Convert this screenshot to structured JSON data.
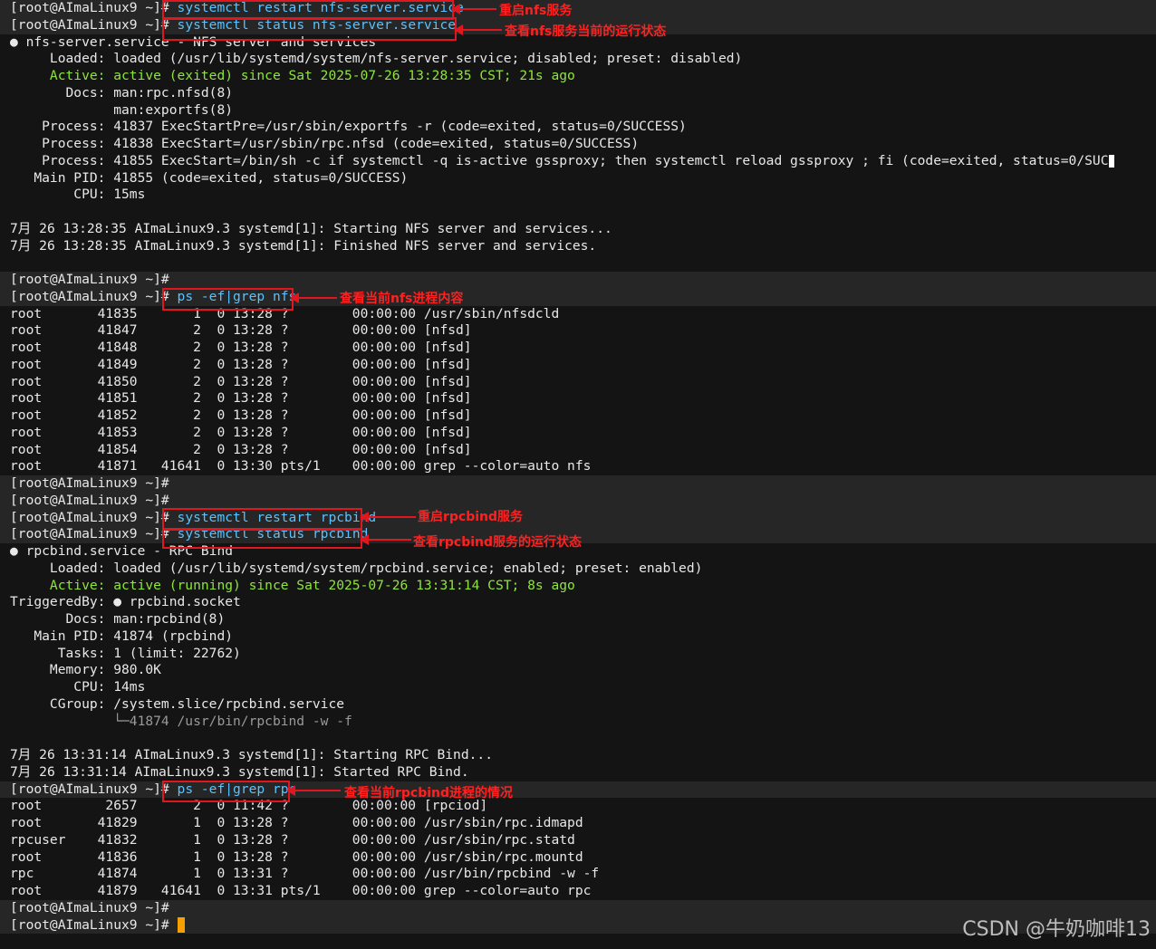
{
  "prompt": "[root@AImaLinux9 ~]#",
  "cmds": {
    "c1": "systemctl restart nfs-server.service",
    "c2": "systemctl status nfs-server.service",
    "c3": "ps -ef|grep nfs",
    "c4": "systemctl restart rpcbind",
    "c5": "systemctl status rpcbind",
    "c6": "ps -ef|grep rpc"
  },
  "annotations": {
    "a1": "重启nfs服务",
    "a2": "查看nfs服务当前的运行状态",
    "a3": "查看当前nfs进程内容",
    "a4": "重启rpcbind服务",
    "a5": "查看rpcbind服务的运行状态",
    "a6": "查看当前rpcbind进程的情况"
  },
  "nfs_status": {
    "header": "● nfs-server.service - NFS server and services",
    "loaded": "     Loaded: loaded (/usr/lib/systemd/system/nfs-server.service; disabled; preset: disabled)",
    "active": "     Active: active (exited) since Sat 2025-07-26 13:28:35 CST; 21s ago",
    "docs1": "       Docs: man:rpc.nfsd(8)",
    "docs2": "             man:exportfs(8)",
    "p1": "    Process: 41837 ExecStartPre=/usr/sbin/exportfs -r (code=exited, status=0/SUCCESS)",
    "p2": "    Process: 41838 ExecStart=/usr/sbin/rpc.nfsd (code=exited, status=0/SUCCESS)",
    "p3": "    Process: 41855 ExecStart=/bin/sh -c if systemctl -q is-active gssproxy; then systemctl reload gssproxy ; fi (code=exited, status=0/SUC",
    "mainpid": "   Main PID: 41855 (code=exited, status=0/SUCCESS)",
    "cpu": "        CPU: 15ms",
    "log1": "7月 26 13:28:35 AImaLinux9.3 systemd[1]: Starting NFS server and services...",
    "log2": "7月 26 13:28:35 AImaLinux9.3 systemd[1]: Finished NFS server and services."
  },
  "ps_nfs": [
    "root       41835       1  0 13:28 ?        00:00:00 /usr/sbin/nfsdcld",
    "root       41847       2  0 13:28 ?        00:00:00 [nfsd]",
    "root       41848       2  0 13:28 ?        00:00:00 [nfsd]",
    "root       41849       2  0 13:28 ?        00:00:00 [nfsd]",
    "root       41850       2  0 13:28 ?        00:00:00 [nfsd]",
    "root       41851       2  0 13:28 ?        00:00:00 [nfsd]",
    "root       41852       2  0 13:28 ?        00:00:00 [nfsd]",
    "root       41853       2  0 13:28 ?        00:00:00 [nfsd]",
    "root       41854       2  0 13:28 ?        00:00:00 [nfsd]",
    "root       41871   41641  0 13:30 pts/1    00:00:00 grep --color=auto nfs"
  ],
  "rpc_status": {
    "header": "● rpcbind.service - RPC Bind",
    "loaded": "     Loaded: loaded (/usr/lib/systemd/system/rpcbind.service; enabled; preset: enabled)",
    "active": "     Active: active (running) since Sat 2025-07-26 13:31:14 CST; 8s ago",
    "triggered": "TriggeredBy: ● rpcbind.socket",
    "docs": "       Docs: man:rpcbind(8)",
    "mainpid": "   Main PID: 41874 (rpcbind)",
    "tasks": "      Tasks: 1 (limit: 22762)",
    "memory": "     Memory: 980.0K",
    "cpu": "        CPU: 14ms",
    "cgroup": "     CGroup: /system.slice/rpcbind.service",
    "cgroup2": "             └─41874 /usr/bin/rpcbind -w -f",
    "log1": "7月 26 13:31:14 AImaLinux9.3 systemd[1]: Starting RPC Bind...",
    "log2": "7月 26 13:31:14 AImaLinux9.3 systemd[1]: Started RPC Bind."
  },
  "ps_rpc": [
    "root        2657       2  0 11:42 ?        00:00:00 [rpciod]",
    "root       41829       1  0 13:28 ?        00:00:00 /usr/sbin/rpc.idmapd",
    "rpcuser    41832       1  0 13:28 ?        00:00:00 /usr/sbin/rpc.statd",
    "root       41836       1  0 13:28 ?        00:00:00 /usr/sbin/rpc.mountd",
    "rpc        41874       1  0 13:31 ?        00:00:00 /usr/bin/rpcbind -w -f",
    "root       41879   41641  0 13:31 pts/1    00:00:00 grep --color=auto rpc"
  ],
  "watermark": "CSDN @牛奶咖啡13",
  "colors": {
    "box": "#e2161e",
    "cursor": "#f5a000",
    "background": "#141414"
  }
}
